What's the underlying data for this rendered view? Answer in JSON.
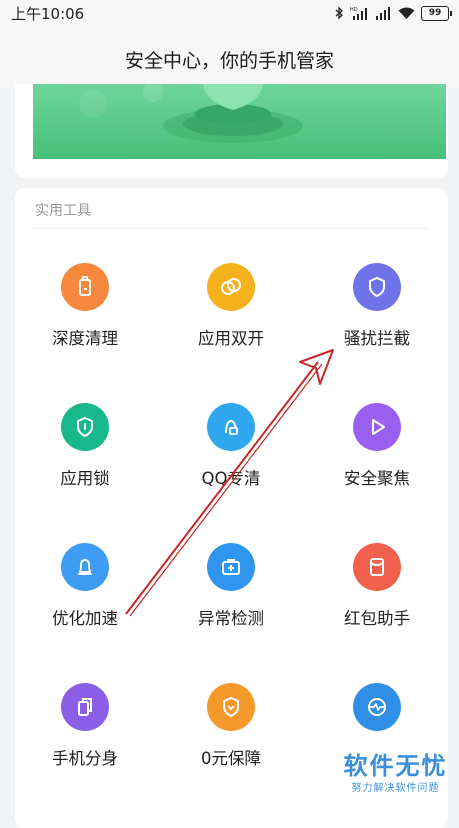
{
  "status_bar": {
    "time": "上午10:06",
    "battery": "99"
  },
  "header": {
    "title": "安全中心，你的手机管家"
  },
  "section": {
    "label": "实用工具"
  },
  "tools": [
    {
      "label": "深度清理",
      "icon": "broom-clean-icon",
      "color": "#f5883d"
    },
    {
      "label": "应用双开",
      "icon": "dual-circles-icon",
      "color": "#f6b21c"
    },
    {
      "label": "骚扰拦截",
      "icon": "shield-icon",
      "color": "#6e73e8"
    },
    {
      "label": "应用锁",
      "icon": "lock-shield-icon",
      "color": "#18b88b"
    },
    {
      "label": "QQ专清",
      "icon": "qq-clean-icon",
      "color": "#2fa7ee"
    },
    {
      "label": "安全聚焦",
      "icon": "play-icon",
      "color": "#9a5ef0"
    },
    {
      "label": "优化加速",
      "icon": "bell-boost-icon",
      "color": "#3e9cf2"
    },
    {
      "label": "异常检测",
      "icon": "medical-kit-icon",
      "color": "#2f95ee"
    },
    {
      "label": "红包助手",
      "icon": "red-envelope-icon",
      "color": "#f0604d"
    },
    {
      "label": "手机分身",
      "icon": "copy-phone-icon",
      "color": "#8a5ee6"
    },
    {
      "label": "0元保障",
      "icon": "guarantee-shield-icon",
      "color": "#f59a2a"
    },
    {
      "label": "",
      "icon": "heart-monitor-icon",
      "color": "#2f8fe6"
    }
  ],
  "watermark": {
    "main": "软件无忧",
    "sub": "努力解决软件问题"
  }
}
